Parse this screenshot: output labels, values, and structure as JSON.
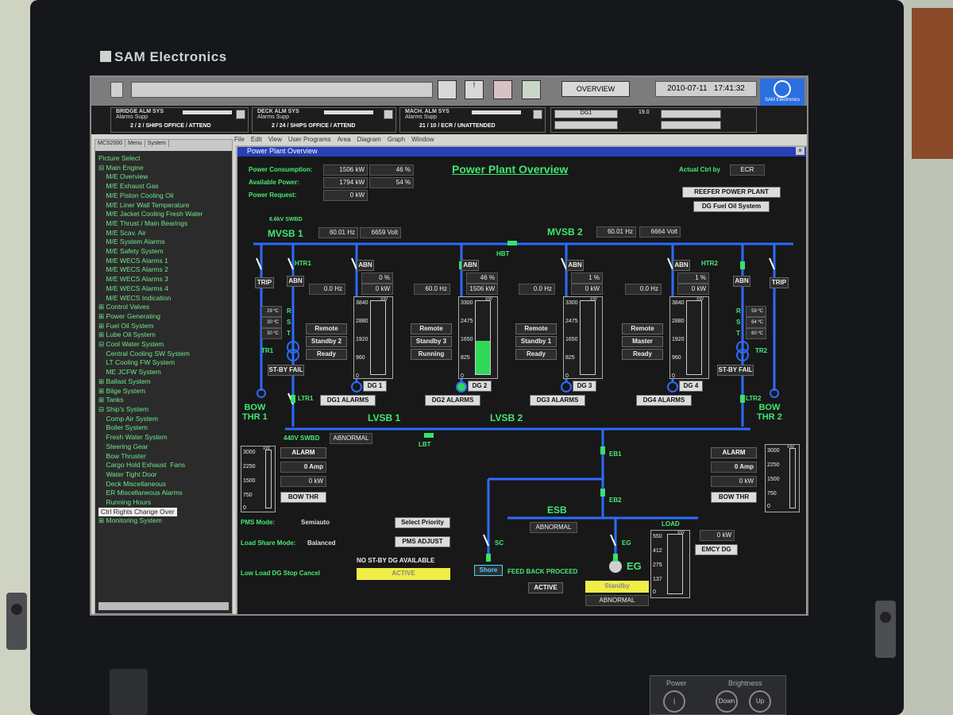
{
  "brand": "SAM Electronics",
  "topbar": {
    "overview": "OVERVIEW",
    "date": "2010-07-11",
    "time": "17:41:32",
    "logo_caption": "SAM Electronics",
    "dg_field": "DG1",
    "dg_value": "19.0"
  },
  "alarm_systems": [
    {
      "title": "BRIDGE ALM SYS",
      "sub": "Alarms   Supp",
      "value": "2 /    2 / SHIPS OFFICE / ATTEND"
    },
    {
      "title": "DECK ALM SYS",
      "sub": "Alarms   Supp",
      "value": "2 /   24 / SHIPS OFFICE / ATTEND"
    },
    {
      "title": "MACH. ALM SYS",
      "sub": "Alarms   Supp",
      "value": "21 /   10 / ECR / UNATTENDED"
    }
  ],
  "left_tabs": [
    "MCS2000",
    "Menu",
    "System"
  ],
  "tree": [
    "Picture Select",
    "⊟ Main Engine",
    "    M/E Overview",
    "    M/E Exhaust Gas",
    "    M/E Piston Cooling Oil",
    "    M/E Liner Wall Temperature",
    "    M/E Jacket Cooling Fresh Water",
    "    M/E Thrust / Main Bearings",
    "    M/E Scav. Air",
    "    M/E System Alarms",
    "    M/E Safety System",
    "    M/E WECS Alarms 1",
    "    M/E WECS Alarms 2",
    "    M/E WECS Alarms 3",
    "    M/E WECS Alarms 4",
    "    M/E WECS Indication",
    "⊞ Control Valves",
    "⊞ Power Generating",
    "⊞ Fuel Oil System",
    "⊞ Lube Oil System",
    "⊟ Cool Water System",
    "    Central Cooling SW System",
    "    LT Cooling FW System",
    "    ME JCFW System",
    "⊞ Ballast System",
    "⊞ Bilge System",
    "⊞ Tanks",
    "⊟ Ship's System",
    "    Comp Air System",
    "    Boiler System",
    "    Fresh Water System",
    "    Steering Gear",
    "    Bow Thruster",
    "    Cargo Hold Exhaust  Fans",
    "    Water Tight Door",
    "    Deck Miscellaneous",
    "    ER Miscellaneous Alarms",
    "    Running Hours",
    "Ctrl Rights Change Over",
    "⊞ Monitoring System"
  ],
  "menu": [
    "File",
    "Edit",
    "View",
    "User Programs",
    "Area",
    "Diagram",
    "Graph",
    "Window"
  ],
  "window_title": "Power Plant Overview",
  "plant": {
    "title": "Power Plant Overview",
    "power_consumption_label": "Power Consumption:",
    "power_consumption_kw": "1506 kW",
    "power_consumption_pct": "46 %",
    "available_power_label": "Available Power:",
    "available_power_kw": "1794 kW",
    "available_power_pct": "54 %",
    "power_request_label": "Power Request:",
    "power_request_kw": "0 kW",
    "actual_ctrl_label": "Actual Ctrl by",
    "actual_ctrl_value": "ECR",
    "reefer_btn": "REEFER POWER PLANT",
    "dgfuel_btn": "DG Fuel Oil System",
    "swbd_66": "6.6kV SWBD",
    "mvsb1": "MVSB 1",
    "mvsb1_hz": "60.01 Hz",
    "mvsb1_volt": "6659 Volt",
    "mvsb2": "MVSB 2",
    "mvsb2_hz": "60.01 Hz",
    "mvsb2_volt": "6664 Volt",
    "hbt": "HBT",
    "trip": "TRIP",
    "abn": "ABN",
    "htr1": "HTR1",
    "htr2": "HTR2",
    "tr1": "TR1",
    "tr2": "TR2",
    "stby_fail": "ST-BY FAIL",
    "ltr1": "LTR1",
    "ltr2": "LTR2",
    "bow1": "BOW\nTHR 1",
    "bow2": "BOW\nTHR 2",
    "r": "R",
    "s": "S",
    "t": "T",
    "tr1_temps": [
      "29 ºC",
      "30 ºC",
      "30 ºC"
    ],
    "tr2_temps": [
      "59 ºC",
      "64 ºC",
      "60 ºC"
    ],
    "gens": [
      {
        "name": "DG 1",
        "alarms": "DG1 ALARMS",
        "hz": "0.0 Hz",
        "pct": "0 %",
        "kw": "0 kW",
        "mode": "Remote",
        "role": "Standby 2",
        "state": "Ready",
        "scale": [
          "3840",
          "2880",
          "1920",
          "960",
          "0"
        ],
        "fill": 0
      },
      {
        "name": "DG 2",
        "alarms": "DG2 ALARMS",
        "hz": "60.0 Hz",
        "pct": "46 %",
        "kw": "1506 kW",
        "mode": "Remote",
        "role": "Standby 3",
        "state": "Running",
        "scale": [
          "3300",
          "2475",
          "1650",
          "825",
          "0"
        ],
        "fill": 0.46
      },
      {
        "name": "DG 3",
        "alarms": "DG3 ALARMS",
        "hz": "0.0 Hz",
        "pct": "1 %",
        "kw": "0 kW",
        "mode": "Remote",
        "role": "Standby 1",
        "state": "Ready",
        "scale": [
          "3300",
          "2475",
          "1650",
          "825",
          "0"
        ],
        "fill": 0
      },
      {
        "name": "DG 4",
        "alarms": "DG4 ALARMS",
        "hz": "0.0 Hz",
        "pct": "1 %",
        "kw": "0 kW",
        "mode": "Remote",
        "role": "Master",
        "state": "Ready",
        "scale": [
          "3840",
          "2880",
          "1920",
          "960",
          "0"
        ],
        "fill": 0
      }
    ],
    "kw_unit": "kW",
    "lvsb1": "LVSB 1",
    "lvsb2": "LVSB 2",
    "swbd_440": "440V SWBD",
    "abnormal": "ABNORMAL",
    "lbt": "LBT",
    "eb1": "EB1",
    "eb2": "EB2",
    "esb": "ESB",
    "sc": "SC",
    "eg": "EG",
    "eg_big": "EG",
    "shore": "Shore",
    "feedback": "FEED BACK PROCEED",
    "active": "ACTIVE",
    "standby": "Standby",
    "load": "LOAD",
    "eg_kw": "0 kW",
    "emcy_dg": "EMCY DG",
    "bow_left": {
      "alarm": "ALARM",
      "amp": "0 Amp",
      "kw": "0 kW",
      "btn": "BOW THR",
      "scale": [
        "3000",
        "2250",
        "1500",
        "750",
        "0"
      ]
    },
    "bow_right": {
      "alarm": "ALARM",
      "amp": "0 Amp",
      "kw": "0 kW",
      "btn": "BOW THR",
      "scale": [
        "3000",
        "2250",
        "1500",
        "750",
        "0"
      ]
    },
    "eg_scale": [
      "550",
      "412",
      "275",
      "137",
      "0"
    ],
    "pms_mode_label": "PMS Mode:",
    "pms_mode_value": "Semiauto",
    "select_priority": "Select Priority",
    "load_share_label": "Load Share Mode:",
    "load_share_value": "Balanced",
    "pms_adjust": "PMS ADJUST",
    "no_stby": "NO ST-BY DG AVAILABLE",
    "low_load_label": "Low Load DG Stop Cancel",
    "low_load_value": "ACTIVE"
  },
  "controls": {
    "power": "Power",
    "brightness": "Brightness",
    "down": "Down",
    "up": "Up"
  },
  "colors": {
    "accent_green": "#3ee870",
    "bus_blue": "#2c6bff",
    "status_yellow": "#f0ec48"
  }
}
